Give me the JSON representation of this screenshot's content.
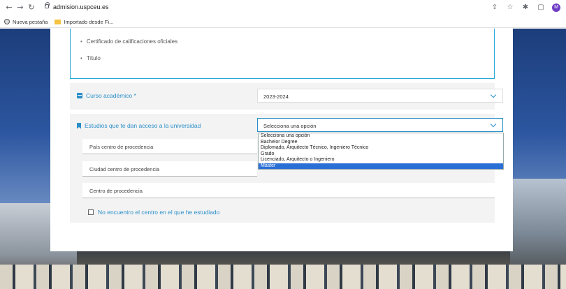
{
  "browser": {
    "url": "admision.uspceu.es",
    "bookmarks": [
      "Nueva pestaña",
      "Importado desde Fi..."
    ],
    "avatar_letter": "M"
  },
  "form": {
    "documents": [
      "Certificado de calificaciones oficiales",
      "Título"
    ],
    "academic_year_label": "Curso académico *",
    "academic_year_value": "2023-2024",
    "studies_label": "Estudios que te dan acceso a la universidad",
    "studies_value": "Selecciona una opción",
    "country_placeholder": "País centro de procedencia",
    "city_placeholder": "Ciudad centro de procedencia",
    "center_placeholder": "Centro de procedencia",
    "not_found_label": "No encuentro el centro en el que he estudiado"
  },
  "dropdown": {
    "options": [
      "Selecciona una opción",
      "Bachelor Degree",
      "Diplomado, Arquitecto Técnico, Ingeniero Técnico",
      "Grado",
      "Licenciado, Arquitecto o Ingeniero",
      "Máster"
    ],
    "selected_index": 5
  }
}
